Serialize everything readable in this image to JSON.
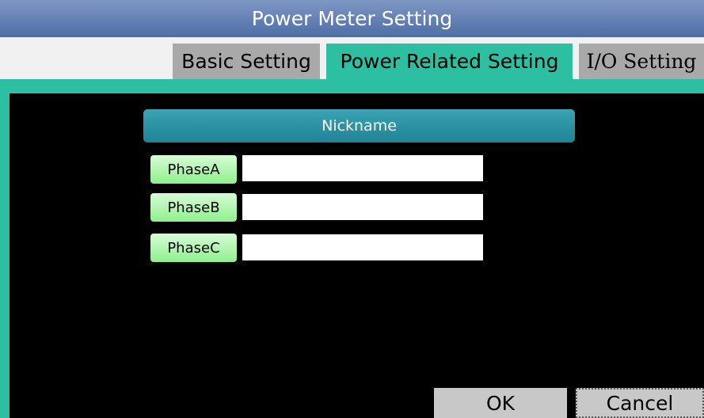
{
  "window": {
    "title": "Power Meter Setting"
  },
  "tabs": {
    "basic": "Basic Setting",
    "power": "Power Related Setting",
    "io": "I/O Setting"
  },
  "panel": {
    "header": "Nickname",
    "phases": [
      {
        "label": "PhaseA",
        "value": ""
      },
      {
        "label": "PhaseB",
        "value": ""
      },
      {
        "label": "PhaseC",
        "value": ""
      }
    ]
  },
  "actions": {
    "ok": "OK",
    "cancel": "Cancel"
  },
  "colors": {
    "title_bar": "#5d7cb2",
    "active_tab": "#2cbfa1",
    "inactive_tab": "#a9a9a9",
    "phase_label": "#a8f5a5"
  }
}
